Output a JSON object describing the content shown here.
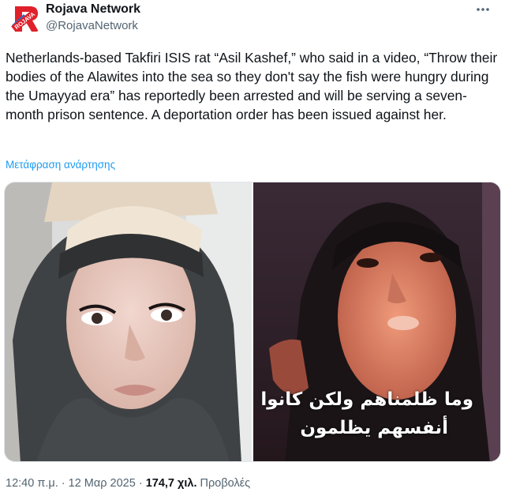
{
  "account": {
    "display_name": "Rojava Network",
    "handle": "@RojavaNetwork",
    "avatar_text": "ROJAVA",
    "brand_color": "#e0202a"
  },
  "more_icon": "more-horizontal-icon",
  "tweet": {
    "text": "Netherlands-based Takfiri ISIS rat “Asil Kashef,” who said in a video, “Throw their bodies of the Alawites into the sea so they don't say the fish were hungry during the Umayyad era” has reportedly been arrested and will be serving a seven-month prison sentence. A deportation order has been issued against her.",
    "translate_label": "Μετάφραση ανάρτησης"
  },
  "media": {
    "right_caption_line1": "وما ظلمناهم ولكن كانوا",
    "right_caption_line2": "أنفسهم يظلمون"
  },
  "meta": {
    "time": "12:40 π.μ.",
    "separator1": "·",
    "date": "12 Μαρ 2025",
    "separator2": "·",
    "views_count": "174,7 χιλ.",
    "views_label": "Προβολές"
  }
}
